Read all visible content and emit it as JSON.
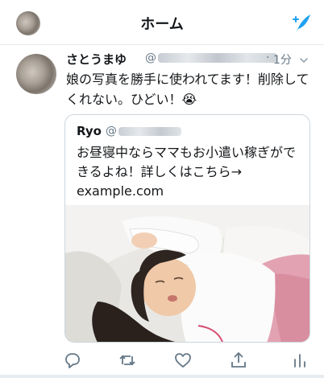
{
  "header": {
    "title": "ホーム"
  },
  "tweet": {
    "name": "さとうまゆ",
    "handle_prefix": "@",
    "dot": "·",
    "time": "1分",
    "text": "娘の写真を勝手に使われてます！削除してくれない。ひどい！😭"
  },
  "quote": {
    "name": "Ryo",
    "handle_prefix": "@",
    "text": "お昼寝中ならママもお小遣い稼ぎができるよね！詳しくはこちら→ example.com"
  },
  "colors": {
    "accent": "#1da1f2",
    "secondary_text": "#657786",
    "border": "#ccd6dd",
    "icon_gray": "#657786"
  },
  "icons": [
    "compose-icon",
    "caret-down-icon",
    "reply-icon",
    "retweet-icon",
    "like-icon",
    "share-icon",
    "analytics-icon"
  ]
}
